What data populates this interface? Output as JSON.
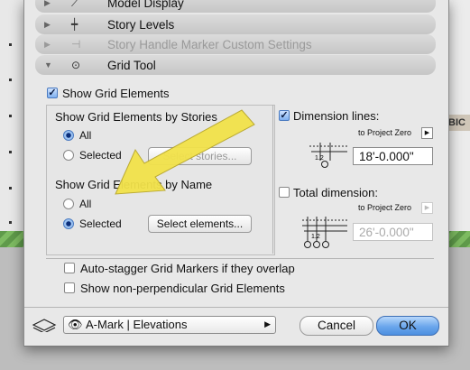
{
  "sections": [
    {
      "label": "Model Display",
      "icon": "model-display-icon",
      "expanded": false,
      "dimmed": false
    },
    {
      "label": "Story Levels",
      "icon": "story-levels-icon",
      "expanded": false,
      "dimmed": false
    },
    {
      "label": "Story Handle Marker Custom Settings",
      "icon": "story-handle-icon",
      "expanded": false,
      "dimmed": true
    },
    {
      "label": "Grid Tool",
      "icon": "grid-tool-icon",
      "expanded": true,
      "dimmed": false
    }
  ],
  "show_grid_elements": {
    "label": "Show Grid Elements",
    "checked": true
  },
  "by_stories": {
    "title": "Show Grid Elements by Stories",
    "all_label": "All",
    "selected_label": "Selected",
    "selected_option": "All",
    "button_label": "Select stories..."
  },
  "by_name": {
    "title": "Show Grid Elements by Name",
    "all_label": "All",
    "selected_label": "Selected",
    "selected_option": "Selected",
    "button_label": "Select elements..."
  },
  "dimension_lines": {
    "label": "Dimension lines:",
    "checked": true,
    "ref": "to Project Zero",
    "value": "18'-0.000\"",
    "marker_label": "1.2"
  },
  "total_dimension": {
    "label": "Total dimension:",
    "checked": false,
    "ref": "to Project Zero",
    "value": "26'-0.000\"",
    "marker_label": "1.2"
  },
  "options": [
    {
      "label": "Auto-stagger Grid Markers if they overlap",
      "checked": false
    },
    {
      "label": "Show non-perpendicular Grid Elements",
      "checked": false
    }
  ],
  "footer": {
    "layer_combo": "A-Mark | Elevations",
    "cancel_label": "Cancel",
    "ok_label": "OK"
  },
  "background": {
    "bic_text": "BIC"
  },
  "colors": {
    "annotation_arrow": "#f2e24a",
    "ok_button": "#6aa6ec"
  }
}
